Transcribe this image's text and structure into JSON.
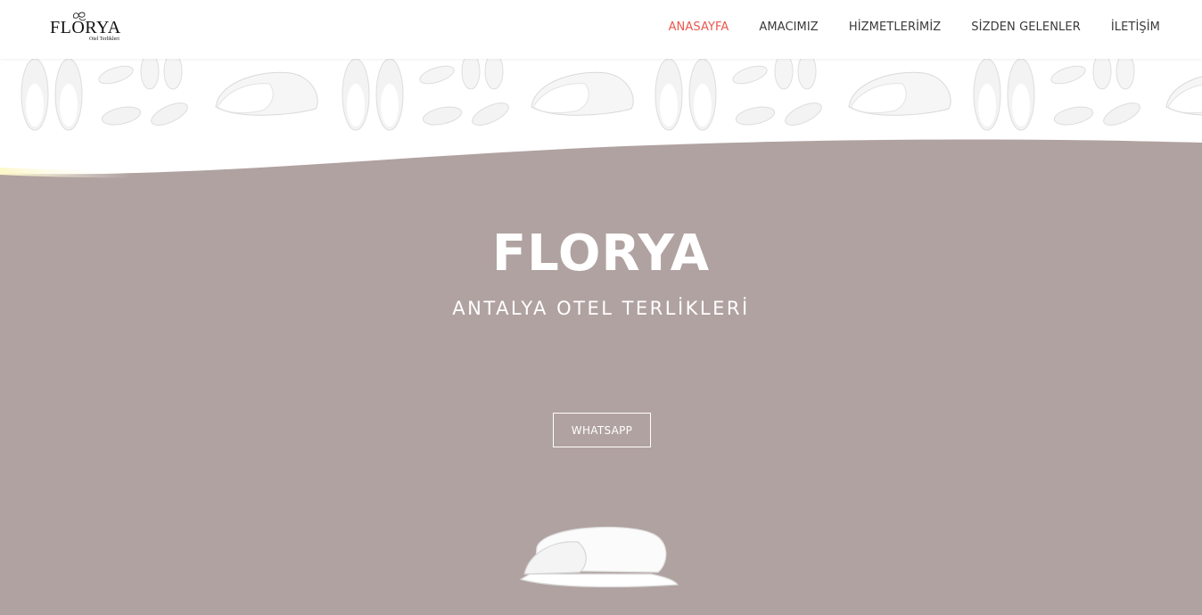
{
  "header": {
    "logo_text": "FLORYA",
    "logo_subtext": "Otel Terlikleri",
    "nav": [
      {
        "label": "ANASAYFA",
        "active": true
      },
      {
        "label": "AMACIMIZ",
        "active": false
      },
      {
        "label": "HİZMETLERİMİZ",
        "active": false
      },
      {
        "label": "SİZDEN GELENLER",
        "active": false
      },
      {
        "label": "İLETİŞİM",
        "active": false
      }
    ]
  },
  "hero": {
    "title": "FLORYA",
    "subtitle": "ANTALYA OTEL TERLİKLERİ",
    "button_label": "WHATSAPP"
  },
  "colors": {
    "accent": "#e8574e",
    "hero_background": "#b0a2a0",
    "nav_text": "#3a3a3a",
    "wave_glow": "#fdf7c8"
  },
  "icons": [
    "florya-logo-mark-icon",
    "slipper-pattern",
    "slipper-product-image"
  ]
}
